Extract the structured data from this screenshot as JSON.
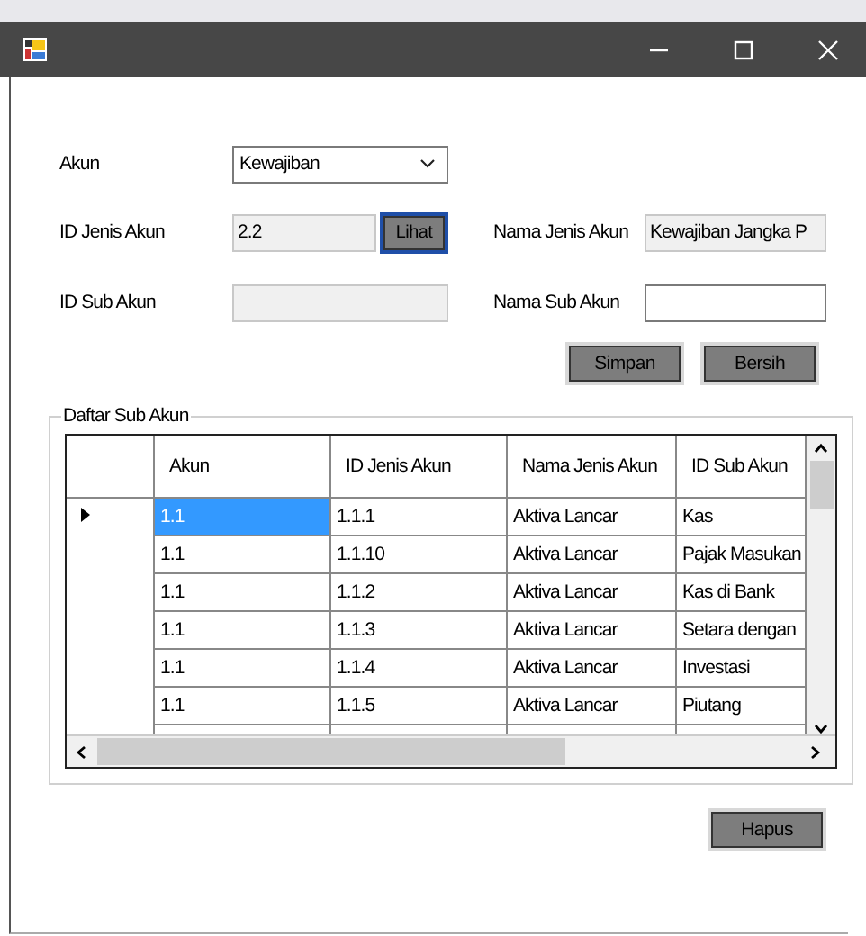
{
  "form": {
    "fields": [
      {
        "kind": "combo",
        "label": "Akun",
        "value": "Kewajiban"
      },
      {
        "kind": "readonly_button",
        "label": "ID Jenis Akun",
        "value": "2.2",
        "button": "Lihat"
      },
      {
        "kind": "readonly",
        "label": "Nama Jenis Akun",
        "value": "Kewajiban Jangka P"
      },
      {
        "kind": "readonly",
        "label": "ID Sub Akun"
      },
      {
        "kind": "text",
        "label": "Nama Sub Akun"
      }
    ],
    "buttons": [
      "Simpan",
      "Bersih"
    ]
  },
  "group": {
    "title": "Daftar Sub Akun",
    "table": {
      "columns": [
        "Akun",
        "ID Jenis Akun",
        "Nama Jenis Akun",
        "ID Sub Akun"
      ],
      "rows": [
        {
          "selected": true,
          "cells": [
            "1.1",
            "1.1.1",
            "Aktiva Lancar",
            "Kas"
          ]
        },
        {
          "selected": false,
          "cells": [
            "1.1",
            "1.1.10",
            "Aktiva Lancar",
            "Pajak Masukan"
          ]
        },
        {
          "selected": false,
          "cells": [
            "1.1",
            "1.1.2",
            "Aktiva Lancar",
            "Kas di Bank"
          ]
        },
        {
          "selected": false,
          "cells": [
            "1.1",
            "1.1.3",
            "Aktiva Lancar",
            "Setara dengan"
          ]
        },
        {
          "selected": false,
          "cells": [
            "1.1",
            "1.1.4",
            "Aktiva Lancar",
            "Investasi"
          ]
        },
        {
          "selected": false,
          "cells": [
            "1.1",
            "1.1.5",
            "Aktiva Lancar",
            "Piutang"
          ]
        }
      ]
    }
  },
  "delete_button": "Hapus"
}
